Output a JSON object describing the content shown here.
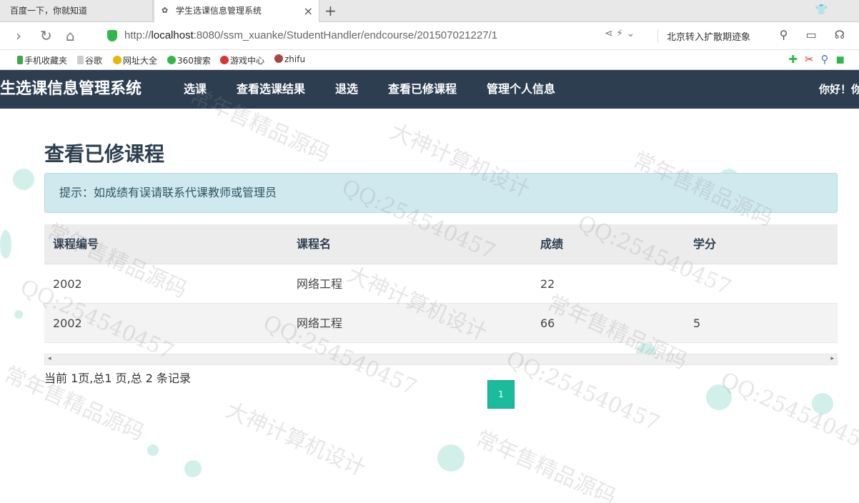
{
  "browser": {
    "tabs": [
      {
        "label": "百度一下，你就知道",
        "active": false
      },
      {
        "label": "学生选课信息管理系统",
        "active": true
      }
    ],
    "url_prefix": "http://",
    "url_host": "localhost",
    "url_rest": ":8080/ssm_xuanke/StudentHandler/endcourse/201507021227/1",
    "news_ticker": "北京转入扩散期迹象",
    "bookmarks": [
      "手机收藏夹",
      "谷歌",
      "网址大全",
      "360搜索",
      "游戏中心",
      "zhifu"
    ]
  },
  "navbar": {
    "brand": "生选课信息管理系统",
    "items": [
      "选课",
      "查看选课结果",
      "退选",
      "查看已修课程",
      "管理个人信息"
    ],
    "greeting": "你好！你"
  },
  "main": {
    "title": "查看已修课程",
    "alert": "提示：如成绩有误请联系代课教师或管理员",
    "table": {
      "headers": [
        "课程编号",
        "课程名",
        "成绩",
        "学分"
      ],
      "rows": [
        [
          "2002",
          "网络工程",
          "22",
          ""
        ],
        [
          "2002",
          "网络工程",
          "66",
          "5"
        ]
      ]
    },
    "page_info": "当前 1页,总1 页,总 2 条记录",
    "pager_current": "1"
  },
  "watermark": {
    "lines": [
      "常年售精品源码",
      "QQ:254540457",
      "大神计算机设计"
    ]
  },
  "colors": {
    "navbar": "#2c3e50",
    "accent": "#1abc9c",
    "alert_bg": "#d0e9ef"
  }
}
